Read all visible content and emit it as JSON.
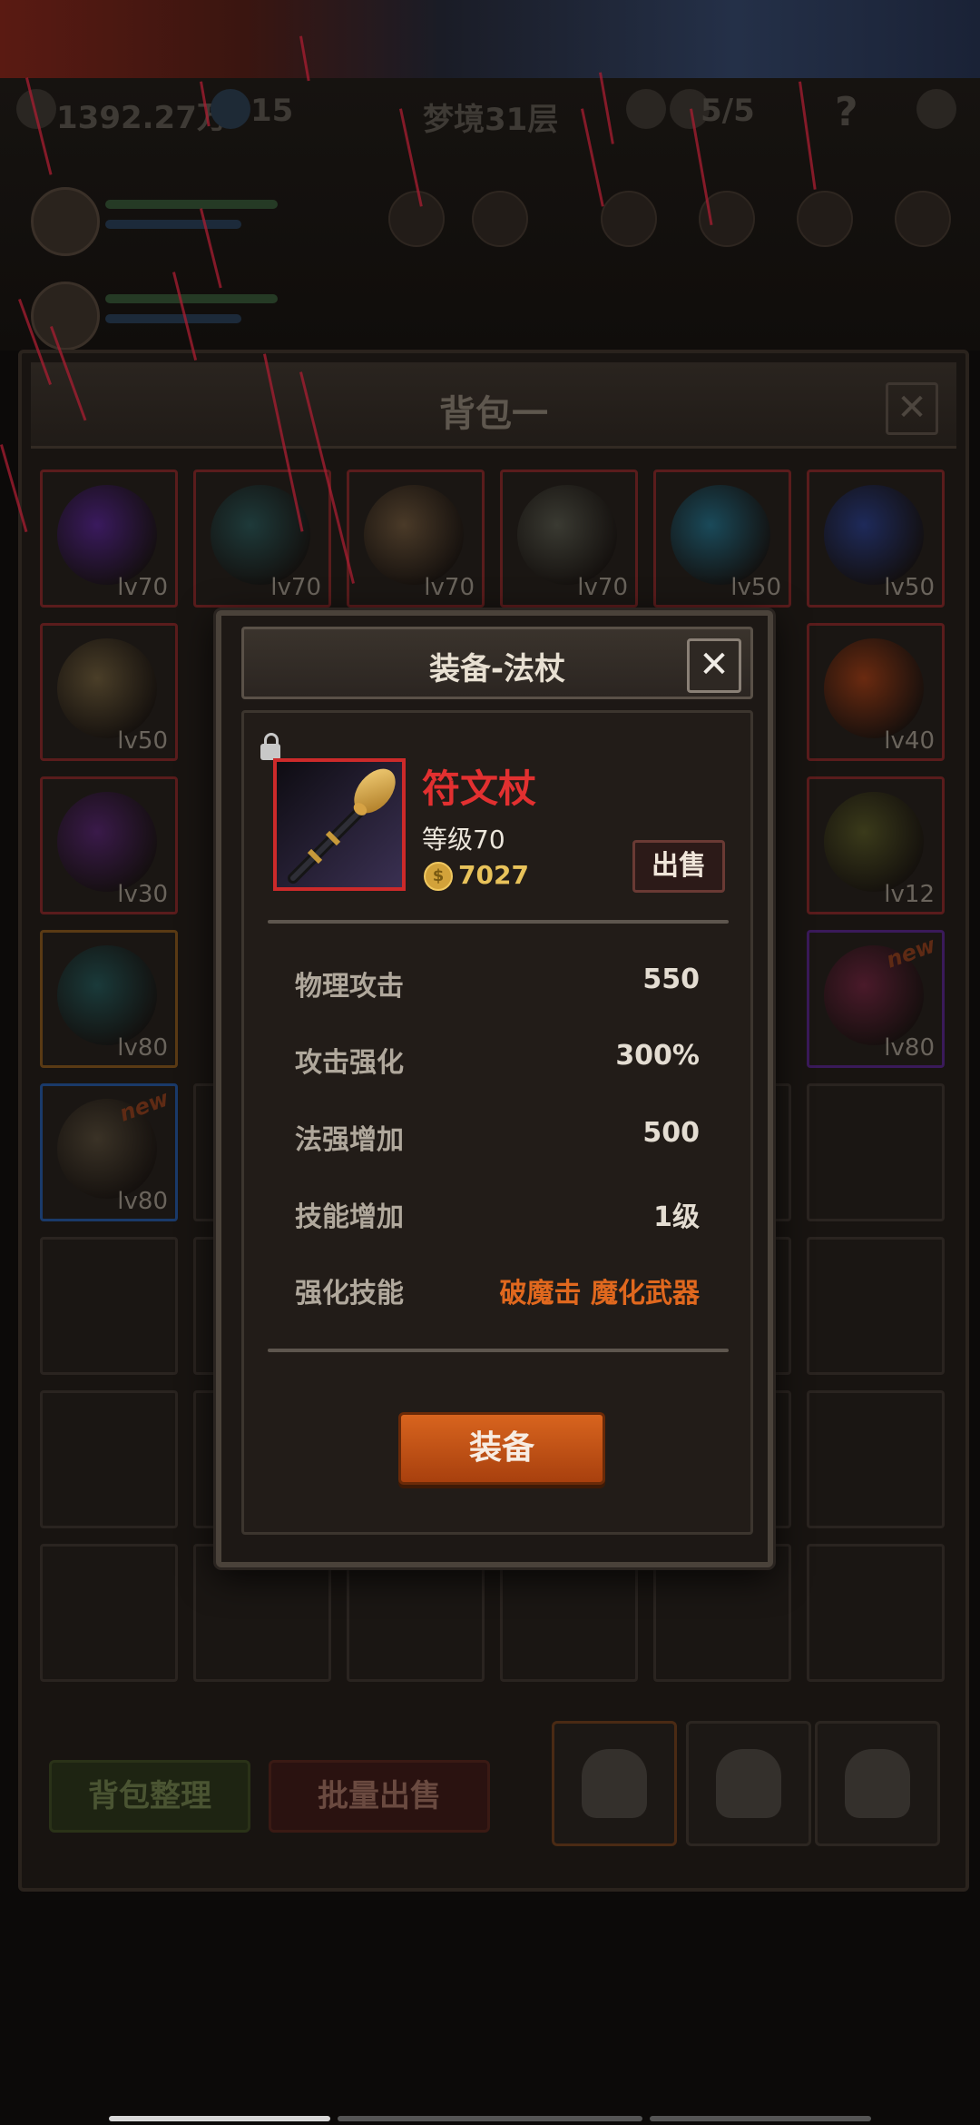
{
  "hud": {
    "currency": "1392.27万",
    "gems": "15",
    "stage": "梦境31层",
    "keys": "5/5",
    "help": "?"
  },
  "inventory": {
    "title": "背包一",
    "close": "✕",
    "slots": [
      {
        "lv": "lv70",
        "color": "#3a1a5e",
        "rarity": "#5a1c1c",
        "new": ""
      },
      {
        "lv": "lv70",
        "color": "#1e3a3a",
        "rarity": "#5a1c1c",
        "new": ""
      },
      {
        "lv": "lv70",
        "color": "#4a3a28",
        "rarity": "#5a1c1c",
        "new": ""
      },
      {
        "lv": "lv70",
        "color": "#3a3a32",
        "rarity": "#5a1c1c",
        "new": ""
      },
      {
        "lv": "lv50",
        "color": "#1a4a5a",
        "rarity": "#5a1c1c",
        "new": ""
      },
      {
        "lv": "lv50",
        "color": "#1e2a5a",
        "rarity": "#5a1c1c",
        "new": ""
      },
      {
        "lv": "lv50",
        "color": "#4a3e28",
        "rarity": "#5a1c1c",
        "new": ""
      },
      {
        "lv": "lv40",
        "color": "#6a2a10",
        "rarity": "#5a1c1c",
        "new": ""
      },
      {
        "lv": "lv30",
        "color": "#3a1a4a",
        "rarity": "#5a1c1c",
        "new": ""
      },
      {
        "lv": "lv12",
        "color": "#3a3a1a",
        "rarity": "#5a1c1c",
        "new": ""
      },
      {
        "lv": "lv80",
        "color": "#1a3a3a",
        "rarity": "#5a3a14",
        "new": ""
      },
      {
        "lv": "lv80",
        "color": "#4a1a2a",
        "rarity": "#3a1a5a",
        "new": "new"
      },
      {
        "lv": "lv80",
        "color": "#3a3226",
        "rarity": "#1a3a6a",
        "new": "new"
      }
    ],
    "sort_button": "背包整理",
    "bulk_sell_button": "批量出售"
  },
  "modal": {
    "title": "装备-法杖",
    "close": "✕",
    "item_name": "符文杖",
    "item_level": "等级70",
    "price": "7027",
    "coin_symbol": "$",
    "sell": "出售",
    "stats": [
      {
        "label": "物理攻击",
        "value": "550"
      },
      {
        "label": "攻击强化",
        "value": "300%"
      },
      {
        "label": "法强增加",
        "value": "500"
      },
      {
        "label": "技能增加",
        "value": "1级"
      },
      {
        "label": "强化技能",
        "value": "破魔击 魔化武器"
      }
    ],
    "equip": "装备"
  }
}
